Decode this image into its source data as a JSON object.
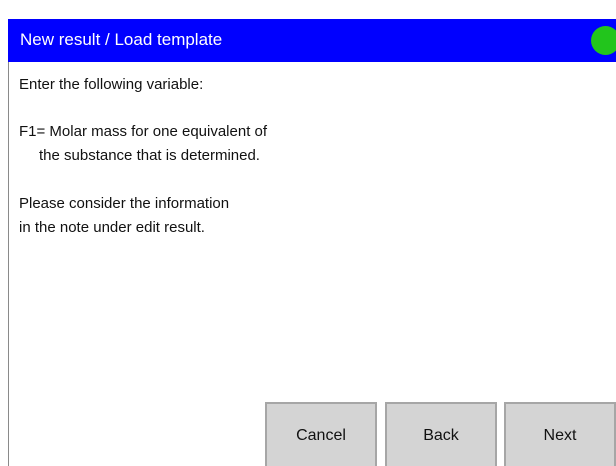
{
  "header": {
    "title": "New result / Load template",
    "status_color": "#22c51c",
    "bar_color": "#0000ff"
  },
  "body": {
    "intro": "Enter the following variable:",
    "variable_line1": "F1= Molar mass for one equivalent of",
    "variable_line2": "the substance that is determined.",
    "note_line1": "Please consider the information",
    "note_line2": "in the note under edit result."
  },
  "buttons": {
    "cancel": "Cancel",
    "back": "Back",
    "next": "Next"
  }
}
